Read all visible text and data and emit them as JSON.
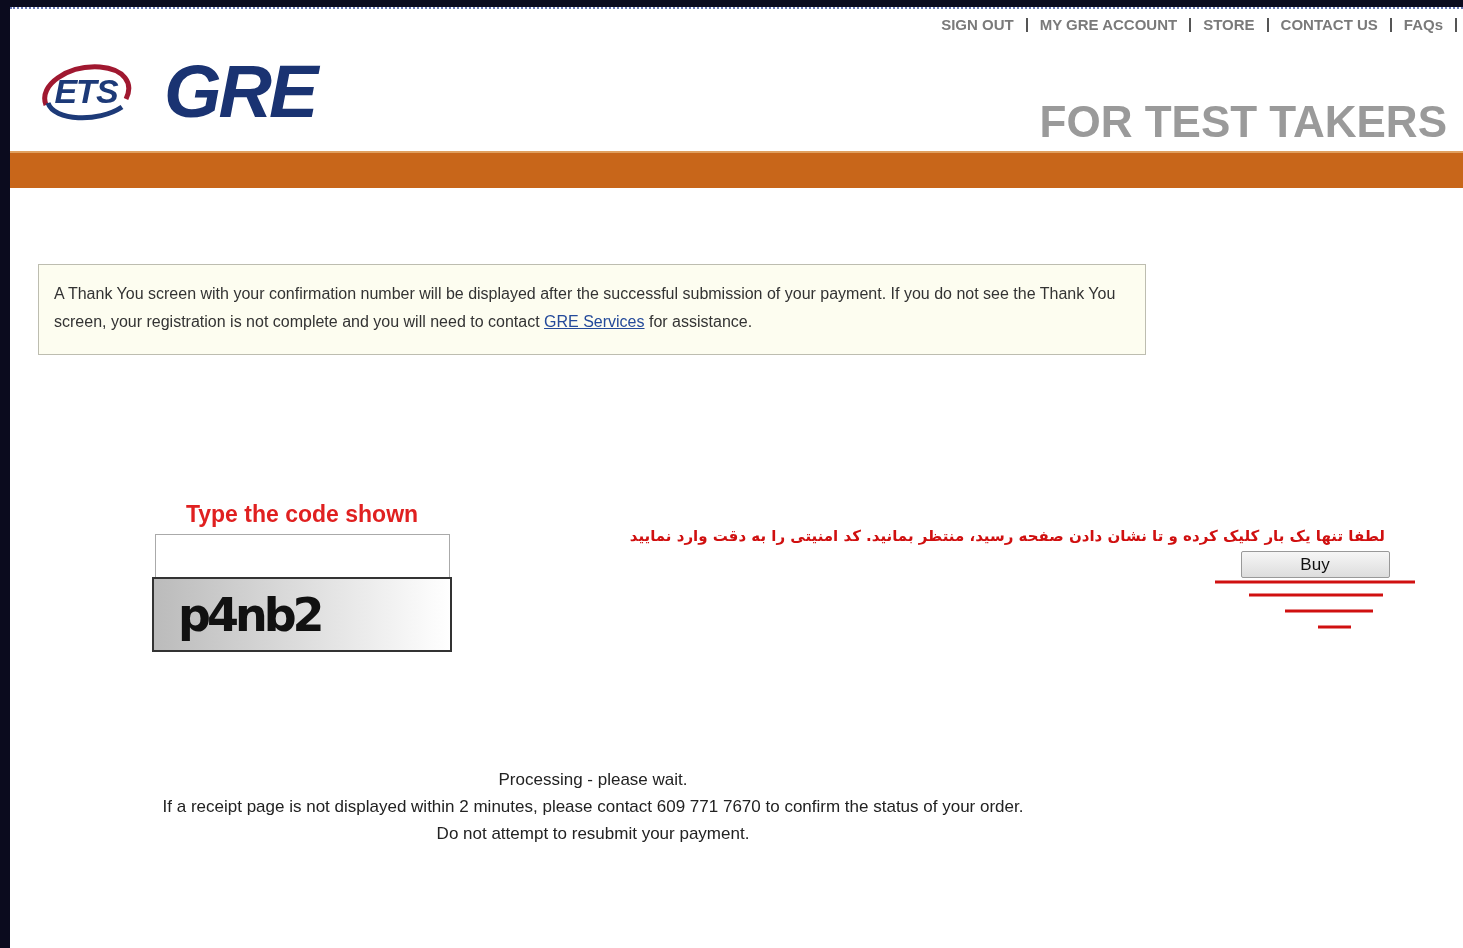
{
  "top_nav": [
    "SIGN OUT",
    "MY GRE ACCOUNT",
    "STORE",
    "CONTACT US",
    "FAQs"
  ],
  "logo": {
    "ets": "ETS",
    "gre": "GRE"
  },
  "header_title": "FOR TEST TAKERS",
  "notice": {
    "before": "A Thank You screen with your confirmation number will be displayed after the successful submission of your payment. If you do not see the Thank You screen, your registration is not complete and you will need to contact",
    "link": "GRE Services",
    "after": "for assistance."
  },
  "captcha": {
    "label": "Type the code shown",
    "code": "p4nb2"
  },
  "persian_note": "لطفا تنها یک بار کلیک کرده و تا نشان دادن صفحه رسید، منتظر بمانید. کد امنیتی را به دقت وارد نمایید",
  "buy_button": "Buy",
  "processing": [
    "Processing - please wait.",
    "If a receipt page is not displayed within 2 minutes, please contact 609 771 7670 to confirm the status of your order.",
    "Do not attempt to resubmit your payment."
  ]
}
